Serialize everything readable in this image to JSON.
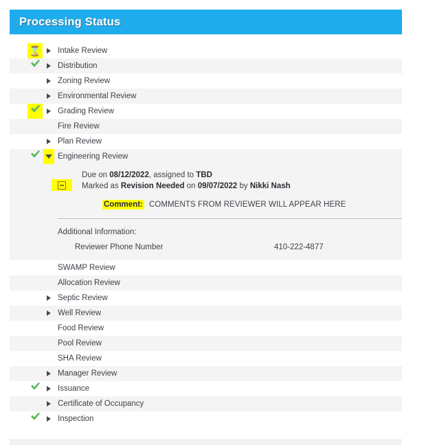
{
  "header": {
    "title": "Processing Status",
    "accent_color": "#1FACEC",
    "title_color": "#ffffff"
  },
  "highlight_color": "#ffff00",
  "check_color": "#5CB85C",
  "icons": {
    "hourglass": "⌛",
    "check": "check-icon",
    "arrow_right": "arrow-right-icon",
    "arrow_down": "arrow-down-icon",
    "minus_box": "minus-box-icon"
  },
  "rows": [
    {
      "label": "Intake Review",
      "status": "pending",
      "arrow": "right",
      "band": false,
      "status_highlight": true,
      "arrow_highlight": false
    },
    {
      "label": "Distribution",
      "status": "complete",
      "arrow": "right",
      "band": true,
      "status_highlight": false,
      "arrow_highlight": false
    },
    {
      "label": "Zoning Review",
      "status": "none",
      "arrow": "right",
      "band": false,
      "status_highlight": false,
      "arrow_highlight": false
    },
    {
      "label": "Environmental Review",
      "status": "none",
      "arrow": "right",
      "band": true,
      "status_highlight": false,
      "arrow_highlight": false
    },
    {
      "label": "Grading Review",
      "status": "complete",
      "arrow": "right",
      "band": false,
      "status_highlight": true,
      "arrow_highlight": false
    },
    {
      "label": "Fire Review",
      "status": "none",
      "arrow": "none",
      "band": true,
      "status_highlight": false,
      "arrow_highlight": false
    },
    {
      "label": "Plan Review",
      "status": "none",
      "arrow": "right",
      "band": false,
      "status_highlight": false,
      "arrow_highlight": false
    },
    {
      "label": "Engineering Review",
      "status": "complete",
      "arrow": "down",
      "band": true,
      "status_highlight": false,
      "arrow_highlight": true
    }
  ],
  "expanded": {
    "due_prefix": "Due on ",
    "due_date": "08/12/2022",
    "assigned_mid": ", assigned to ",
    "assigned_to": "TBD",
    "marked_prefix": "Marked as ",
    "marked_status": "Revision Needed",
    "marked_mid": " on ",
    "marked_date": "09/07/2022",
    "marked_by_mid": " by ",
    "marked_by": "Nikki Nash",
    "comment_label": "Comment:",
    "comment_text": "COMMENTS FROM REVIEWER WILL APPEAR HERE",
    "additional_title": "Additional Information:",
    "additional_fields": [
      {
        "name": "Reviewer Phone Number",
        "value": "410-222-4877"
      }
    ]
  },
  "rows_after": [
    {
      "label": "SWAMP Review",
      "status": "none",
      "arrow": "none",
      "band": false,
      "status_highlight": false,
      "arrow_highlight": false
    },
    {
      "label": "Allocation Review",
      "status": "none",
      "arrow": "none",
      "band": true,
      "status_highlight": false,
      "arrow_highlight": false
    },
    {
      "label": "Septic Review",
      "status": "none",
      "arrow": "right",
      "band": false,
      "status_highlight": false,
      "arrow_highlight": false
    },
    {
      "label": "Well Review",
      "status": "none",
      "arrow": "right",
      "band": true,
      "status_highlight": false,
      "arrow_highlight": false
    },
    {
      "label": "Food Review",
      "status": "none",
      "arrow": "none",
      "band": false,
      "status_highlight": false,
      "arrow_highlight": false
    },
    {
      "label": "Pool Review",
      "status": "none",
      "arrow": "none",
      "band": true,
      "status_highlight": false,
      "arrow_highlight": false
    },
    {
      "label": "SHA Review",
      "status": "none",
      "arrow": "none",
      "band": false,
      "status_highlight": false,
      "arrow_highlight": false
    },
    {
      "label": "Manager Review",
      "status": "none",
      "arrow": "right",
      "band": true,
      "status_highlight": false,
      "arrow_highlight": false
    },
    {
      "label": "Issuance",
      "status": "complete",
      "arrow": "right",
      "band": false,
      "status_highlight": false,
      "arrow_highlight": false
    },
    {
      "label": "Certificate of Occupancy",
      "status": "none",
      "arrow": "right",
      "band": true,
      "status_highlight": false,
      "arrow_highlight": false
    },
    {
      "label": "Inspection",
      "status": "complete",
      "arrow": "right",
      "band": false,
      "status_highlight": false,
      "arrow_highlight": false
    }
  ]
}
